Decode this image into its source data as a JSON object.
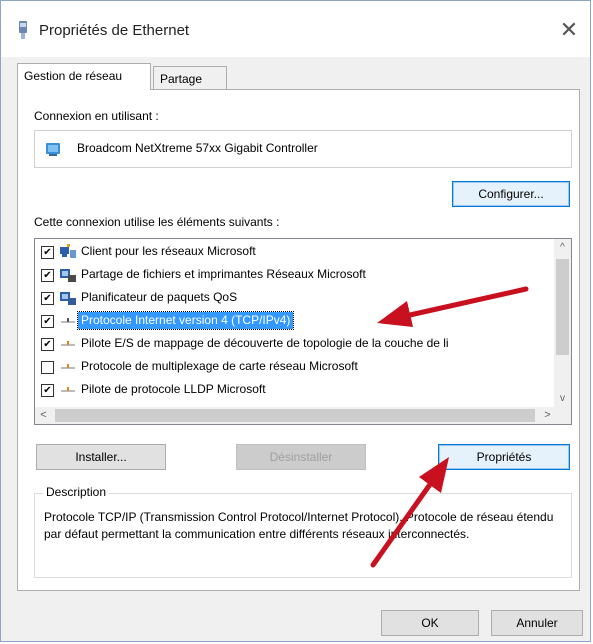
{
  "window": {
    "title": "Propriétés de Ethernet",
    "close_symbol": "✕"
  },
  "tabs": [
    {
      "label": "Gestion de réseau",
      "active": true
    },
    {
      "label": "Partage",
      "active": false
    }
  ],
  "connection": {
    "label": "Connexion en utilisant :",
    "adapter": "Broadcom NetXtreme 57xx Gigabit Controller",
    "configure_label": "Configurer..."
  },
  "items_label": "Cette connexion utilise les éléments suivants :",
  "items": [
    {
      "label": "Client pour les réseaux Microsoft",
      "checked": true,
      "icon": "network-client-icon",
      "selected": false
    },
    {
      "label": "Partage de fichiers et imprimantes Réseaux Microsoft",
      "checked": true,
      "icon": "file-printer-sharing-icon",
      "selected": false
    },
    {
      "label": "Planificateur de paquets QoS",
      "checked": true,
      "icon": "qos-scheduler-icon",
      "selected": false
    },
    {
      "label": "Protocole Internet version 4 (TCP/IPv4)",
      "checked": true,
      "icon": "protocol-icon",
      "selected": true
    },
    {
      "label": "Pilote E/S de mappage de découverte de topologie de la couche de li",
      "checked": true,
      "icon": "protocol-icon",
      "selected": false
    },
    {
      "label": "Protocole de multiplexage de carte réseau Microsoft",
      "checked": false,
      "icon": "protocol-icon",
      "selected": false
    },
    {
      "label": "Pilote de protocole LLDP Microsoft",
      "checked": true,
      "icon": "protocol-icon",
      "selected": false
    }
  ],
  "scroll": {
    "up": "^",
    "down": "v",
    "left": "<",
    "right": ">"
  },
  "buttons": {
    "install": "Installer...",
    "uninstall": "Désinstaller",
    "properties": "Propriétés",
    "ok": "OK",
    "cancel": "Annuler"
  },
  "description": {
    "legend": "Description",
    "text": "Protocole TCP/IP (Transmission Control Protocol/Internet Protocol). Protocole de réseau étendu par défaut permettant la communication entre différents réseaux interconnectés."
  },
  "colors": {
    "selection": "#3399ff",
    "annotation_arrow": "#c8101e",
    "focus_border": "#0078d7"
  }
}
